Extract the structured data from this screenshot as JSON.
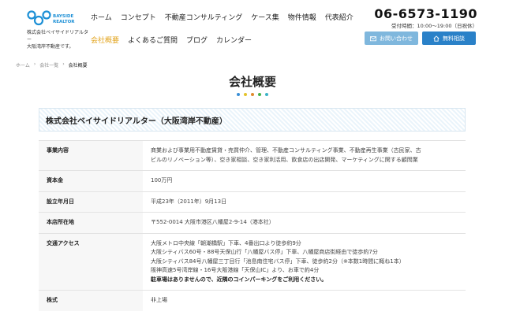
{
  "header": {
    "logo_text": "BAYSIDE REALTOR",
    "company_line1": "株式会社ベイサイドリアルター",
    "company_line2": "大阪湾岸不動産です。",
    "nav_primary": [
      "ホーム",
      "コンセプト",
      "不動産コンサルティング",
      "ケース集",
      "物件情報",
      "代表紹介"
    ],
    "nav_secondary": [
      "会社概要",
      "よくあるご質問",
      "ブログ",
      "カレンダー"
    ],
    "phone": "06-6573-1190",
    "hours": "受付時間：10:00〜19:00（日祝休）",
    "contact_button": "お問い合わせ",
    "consult_button": "無料相談"
  },
  "breadcrumb": [
    "ホーム",
    "会社一覧",
    "会社概要"
  ],
  "page_title": "会社概要",
  "dot_colors": [
    "#3a8fd6",
    "#e4c22a",
    "#e08a2c",
    "#45b24a",
    "#3bb3c7"
  ],
  "company_name": "株式会社ベイサイドリアルター（大阪湾岸不動産）",
  "rows": [
    {
      "label": "事業内容",
      "lines": [
        "商業および事業用不動産賃貸・売買仲介、管理、不動産コンサルティング事業、不動産再生事業（古民家、古",
        "ビルのリノベーション等）、空き家相談、空き家利活用、飲食店の出店開発、マーケティングに関する顧問業"
      ]
    },
    {
      "label": "資本金",
      "lines": [
        "100万円"
      ]
    },
    {
      "label": "設立年月日",
      "lines": [
        "平成23年（2011年）9月13日"
      ]
    },
    {
      "label": "本店所在地",
      "lines": [
        "〒552-0014 大阪市港区八幡屋2-9-14（港本社）"
      ]
    },
    {
      "label": "交通アクセス",
      "lines": [
        "大阪メトロ中央線「朝潮橋駅」下車、4番出口より徒歩約9分",
        "大阪シティバス60号・88号天保山行「八幡屋バス停」下車、八幡屋商店街経由で徒歩約7分",
        "大阪シティバス84号八幡屋三丁目行「池島南住宅バス停」下車、徒歩約2分（※本数1時間に概ね1本）",
        "阪神高速5号湾岸線・16号大阪港線「天保山IC」より、お車で約4分"
      ],
      "note": "駐車場はありませんので、近隣のコインパーキングをご利用ください。"
    },
    {
      "label": "株式",
      "lines": [
        "非上場"
      ]
    }
  ]
}
